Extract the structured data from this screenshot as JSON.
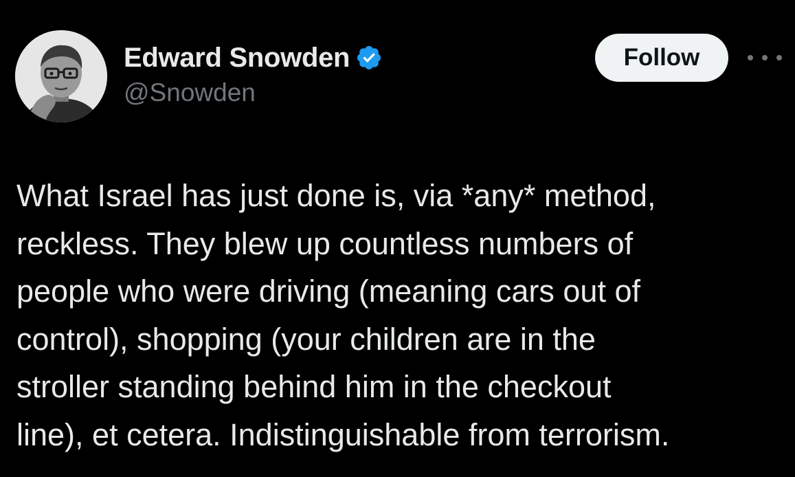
{
  "author": {
    "display_name": "Edward Snowden",
    "handle": "@Snowden",
    "verified": true,
    "verified_color": "#1d9bf0",
    "avatar_icon": "profile-photo"
  },
  "actions": {
    "follow_label": "Follow",
    "more_icon": "more-options-icon"
  },
  "tweet": {
    "lines": [
      "What Israel has just done is, via *any* method,",
      "reckless. They blew up countless numbers of",
      "people who were driving (meaning cars out of",
      "control), shopping (your children are in the",
      "stroller standing behind him in the checkout",
      "line), et cetera. Indistinguishable from terrorism."
    ]
  },
  "colors": {
    "background": "#000000",
    "primary_text": "#e7e9ea",
    "secondary_text": "#71767b",
    "follow_button_bg": "#eff3f4",
    "follow_button_text": "#0f1419"
  }
}
